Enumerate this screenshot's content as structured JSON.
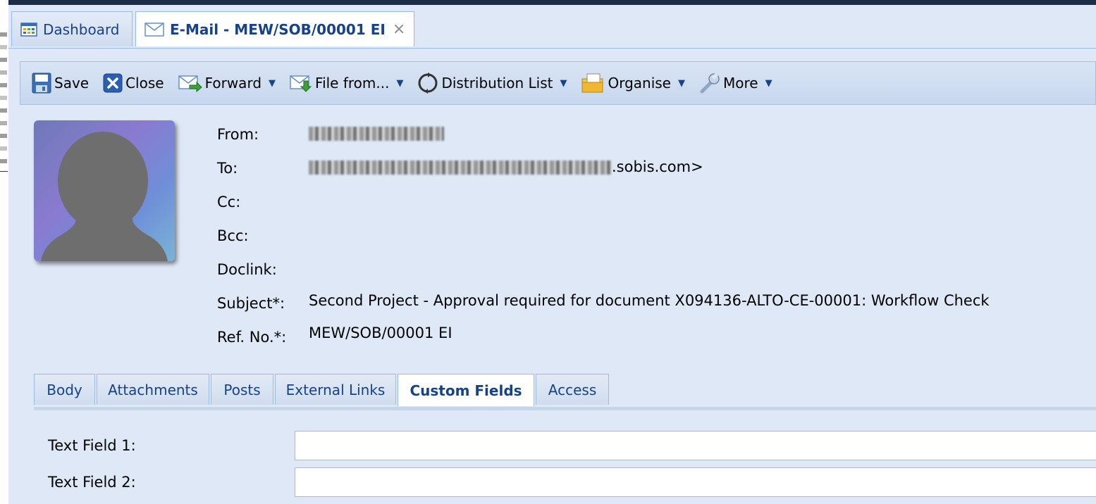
{
  "tabs": [
    {
      "label": "Dashboard",
      "icon": "dashboard-icon",
      "active": false
    },
    {
      "label": "E-Mail - MEW/SOB/00001 EI",
      "icon": "envelope-icon",
      "active": true,
      "close_glyph": "×"
    }
  ],
  "toolbar": {
    "save": "Save",
    "close": "Close",
    "forward": "Forward",
    "file_from": "File from...",
    "distribution_list": "Distribution List",
    "organise": "Organise",
    "more": "More"
  },
  "header": {
    "from_label": "From:",
    "to_label": "To:",
    "to_value_suffix": ".sobis.com>",
    "cc_label": "Cc:",
    "bcc_label": "Bcc:",
    "doclink_label": "Doclink:",
    "subject_label": "Subject*:",
    "subject_value": "Second Project - Approval required for document X094136-ALTO-CE-00001: Workflow Check",
    "ref_label": "Ref. No.*:",
    "ref_value": "MEW/SOB/00001 EI"
  },
  "inner_tabs": [
    {
      "label": "Body",
      "active": false
    },
    {
      "label": "Attachments",
      "active": false
    },
    {
      "label": "Posts",
      "active": false
    },
    {
      "label": "External Links",
      "active": false
    },
    {
      "label": "Custom Fields",
      "active": true
    },
    {
      "label": "Access",
      "active": false
    }
  ],
  "custom_fields": [
    {
      "label": "Text Field 1:",
      "value": ""
    },
    {
      "label": "Text Field 2:",
      "value": ""
    }
  ],
  "colors": {
    "panel_bg": "#dfe8f6",
    "tab_text": "#15428b",
    "border": "#99bbe8",
    "title_bar": "#1c2c47"
  }
}
